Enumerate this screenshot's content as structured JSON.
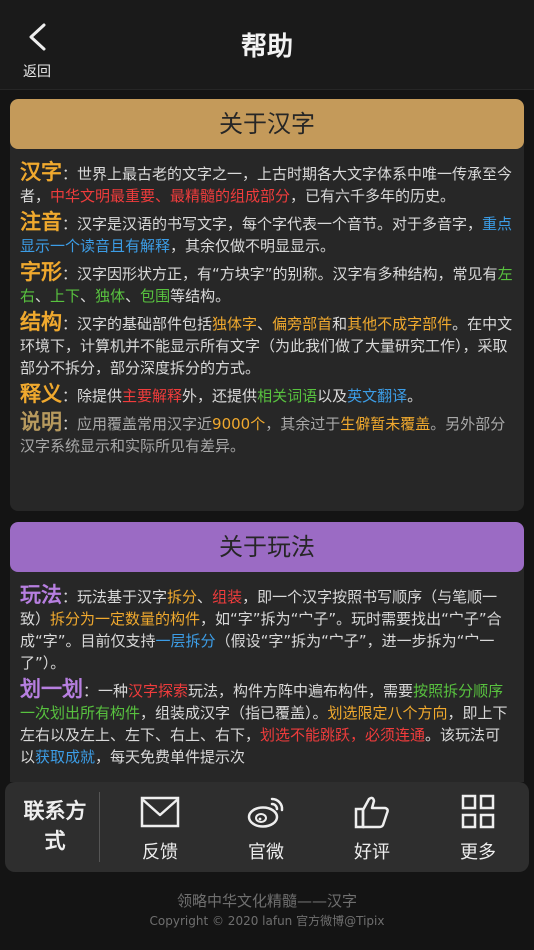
{
  "nav": {
    "back_label": "返回",
    "title": "帮助"
  },
  "colors": {
    "card1_header": "#c49a5a",
    "card2_header": "#9b6bc4"
  },
  "card1": {
    "header": "关于汉字",
    "p1": {
      "term": "汉字",
      "sep": "：",
      "t1": "世界上最古老的文字之一，上古时期各大文字体系中唯一传承至今者，",
      "h1": "中华文明最重要、最精髓的组成部分",
      "t2": "，已有六千多年的历史。"
    },
    "p2": {
      "term": "注音",
      "sep": "：",
      "t1": "汉字是汉语的书写文字，每个字代表一个音节。对于多音字，",
      "h1": "重点显示一个读音且有解释",
      "t2": "，其余仅做不明显显示。"
    },
    "p3": {
      "term": "字形",
      "sep": "：",
      "t1": "汉字因形状方正，有“方块字”的别称。汉字有多种结构，常见有",
      "h1": "左右",
      "t2": "、",
      "h2": "上下",
      "t3": "、",
      "h3": "独体",
      "t4": "、",
      "h4": "包围",
      "t5": "等结构。"
    },
    "p4": {
      "term": "结构",
      "sep": "：",
      "t1": "汉字的基础部件包括",
      "h1": "独体字",
      "t2": "、",
      "h2": "偏旁部首",
      "t3": "和",
      "h3": "其他不成字部件",
      "t4": "。在中文环境下，计算机并不能显示所有文字（为此我们做了大量研究工作），采取部分不拆分，部分深度拆分的方式。"
    },
    "p5": {
      "term": "释义",
      "sep": "：",
      "t1": "除提供",
      "h1": "主要解释",
      "t2": "外，还提供",
      "h2": "相关词语",
      "t3": "以及",
      "h3": "英文翻译",
      "t4": "。"
    },
    "p6": {
      "term": "说明",
      "sep": "：",
      "t1": "应用覆盖常用汉字近",
      "h1": "9000个",
      "t2": "，其余过于",
      "h2": "生僻暂未覆盖",
      "t3": "。另外部分汉字系统显示和实际所见有差异。"
    }
  },
  "card2": {
    "header": "关于玩法",
    "p1": {
      "term": "玩法",
      "sep": "：",
      "t1": "玩法基于汉字",
      "h1": "拆分",
      "t2": "、",
      "h2": "组装",
      "t3": "，即一个汉字按照书写顺序（与笔顺一致）",
      "h3": "拆分为一定数量的构件",
      "t4": "，如“字”拆为“宀子”。玩时需要找出“宀子”合成“字”。目前仅支持",
      "h4": "一层拆分",
      "t5": "（假设“字”拆为“宀子”，进一步拆为“宀一了”）。"
    },
    "p2": {
      "term": "划一划",
      "sep": "：",
      "t1": "一种",
      "h1": "汉字探索",
      "t2": "玩法，构件方阵中遍布构件，需要",
      "h2": "按照拆分顺序一次划出所有构件",
      "t3": "，组装成汉字（指已覆盖）。",
      "h3": "划选限定八个方向",
      "t4": "，即上下左右以及左上、左下、右上、右下，",
      "h4": "划选不能跳跃，必须连通",
      "t5": "。该玩法可以",
      "h5": "获取成就",
      "t6": "，每天免费单件提示次"
    }
  },
  "toolbar": {
    "contact_label": "联系方式",
    "items": [
      {
        "label": "反馈",
        "icon": "mail-icon"
      },
      {
        "label": "官微",
        "icon": "weibo-icon"
      },
      {
        "label": "好评",
        "icon": "thumbs-up-icon"
      },
      {
        "label": "更多",
        "icon": "grid-icon"
      }
    ]
  },
  "footer": {
    "line1": "领略中华文化精髓——汉字",
    "line2": "Copyright © 2020  lafun 官方微博@Tipix"
  }
}
